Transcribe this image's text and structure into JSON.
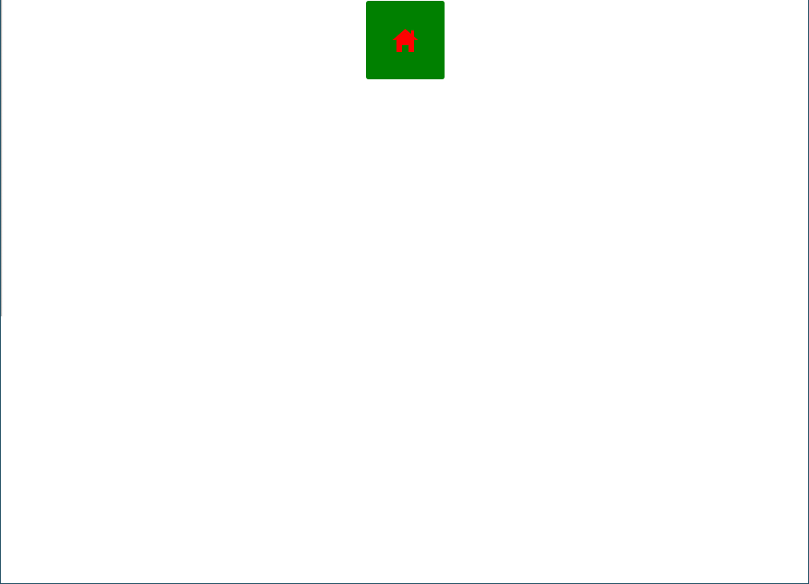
{
  "home_button": {
    "icon": "home-icon",
    "background_color": "#008000",
    "icon_color": "#ff0000"
  },
  "frame": {
    "border_color": "#1f4e63",
    "background_color": "#ffffff"
  }
}
